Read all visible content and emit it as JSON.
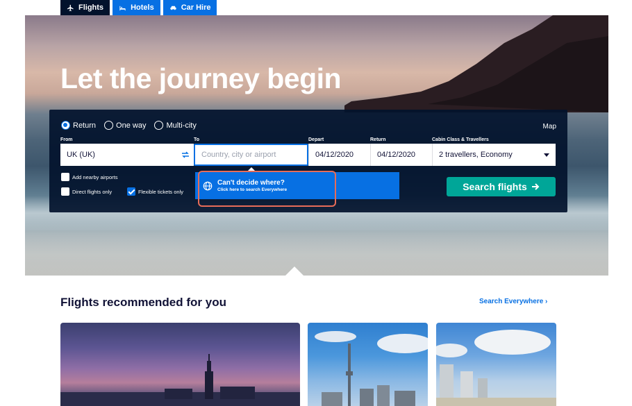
{
  "tabs": [
    {
      "label": "Flights",
      "icon": "plane-icon"
    },
    {
      "label": "Hotels",
      "icon": "bed-icon"
    },
    {
      "label": "Car Hire",
      "icon": "car-icon"
    }
  ],
  "hero": {
    "title": "Let the journey begin"
  },
  "search": {
    "trip_types": [
      "Return",
      "One way",
      "Multi-city"
    ],
    "selected_trip_type": "Return",
    "map_label": "Map",
    "from_label": "From",
    "from_value": "UK (UK)",
    "to_label": "To",
    "to_placeholder": "Country, city or airport",
    "depart_label": "Depart",
    "depart_value": "04/12/2020",
    "return_label": "Return",
    "return_value": "04/12/2020",
    "cabin_label": "Cabin Class & Travellers",
    "cabin_value": "2 travellers, Economy",
    "nearby_airports": "Add nearby airports",
    "direct_flights": "Direct flights only",
    "flexible_tickets": "Flexible tickets only",
    "flexible_checked": true,
    "suggestion_title": "Can't decide where?",
    "suggestion_sub": "Click here to search Everywhere",
    "search_button": "Search flights"
  },
  "recommended": {
    "title": "Flights recommended for you",
    "search_everywhere": "Search Everywhere ›"
  },
  "colors": {
    "brand_blue": "#0770e3",
    "navy": "#02122c",
    "search_green": "#00a698",
    "highlight": "#e76c58"
  }
}
